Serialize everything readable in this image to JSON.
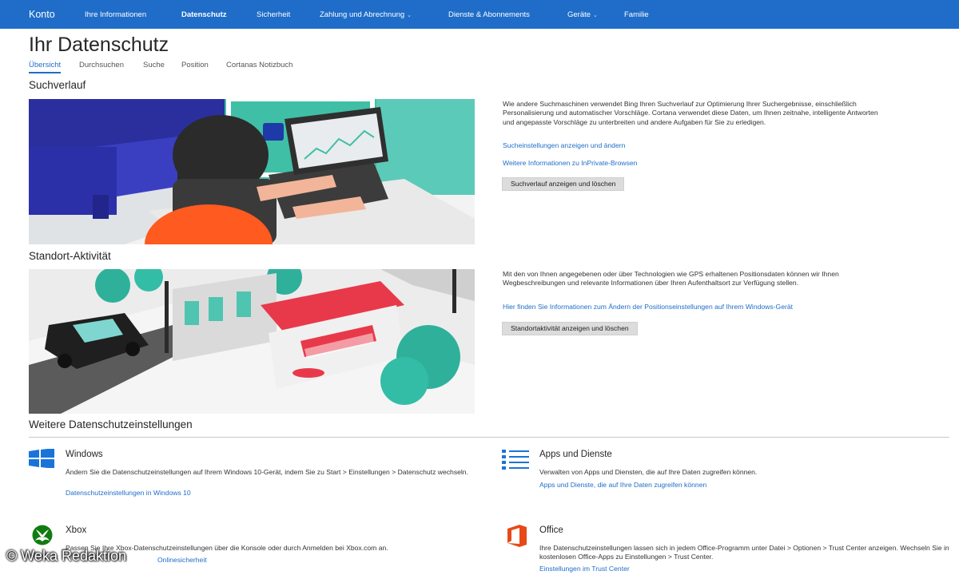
{
  "nav": {
    "brand": "Konto",
    "items": [
      {
        "label": "Ihre Informationen",
        "active": false,
        "dropdown": false
      },
      {
        "label": "Datenschutz",
        "active": true,
        "dropdown": false
      },
      {
        "label": "Sicherheit",
        "active": false,
        "dropdown": false
      },
      {
        "label": "Zahlung und Abrechnung",
        "active": false,
        "dropdown": true
      },
      {
        "label": "Dienste & Abonnements",
        "active": false,
        "dropdown": false
      },
      {
        "label": "Geräte",
        "active": false,
        "dropdown": true
      },
      {
        "label": "Familie",
        "active": false,
        "dropdown": false
      }
    ],
    "caret": "⌄"
  },
  "page": {
    "title": "Ihr Datenschutz",
    "tabs": [
      {
        "label": "Übersicht",
        "active": true
      },
      {
        "label": "Durchsuchen",
        "active": false
      },
      {
        "label": "Suche",
        "active": false
      },
      {
        "label": "Position",
        "active": false
      },
      {
        "label": "Cortanas Notizbuch",
        "active": false
      }
    ]
  },
  "search_history": {
    "heading": "Suchverlauf",
    "description": "Wie andere Suchmaschinen verwendet Bing Ihren Suchverlauf zur Optimierung Ihrer Suchergebnisse, einschließlich Personalisierung und automatischer Vorschläge. Cortana verwendet diese Daten, um Ihnen zeitnahe, intelligente Antworten und angepasste Vorschläge zu unterbreiten und andere Aufgaben für Sie zu erledigen.",
    "link1": "Sucheinstellungen anzeigen und ändern",
    "link2": "Weitere Informationen zu InPrivate-Browsen",
    "button": "Suchverlauf anzeigen und löschen"
  },
  "location": {
    "heading": "Standort-Aktivität",
    "description": "Mit den von Ihnen angegebenen oder über Technologien wie GPS erhaltenen Positionsdaten können wir Ihnen Wegbeschreibungen und relevante Informationen über Ihren Aufenthaltsort zur Verfügung stellen.",
    "link": "Hier finden Sie Informationen zum Ändern der Positionseinstellungen auf Ihrem Windows-Gerät",
    "button": "Standortaktivität anzeigen und löschen"
  },
  "more": {
    "heading": "Weitere Datenschutzeinstellungen",
    "tiles": [
      {
        "title": "Windows",
        "icon": "windows-logo-icon",
        "description": "Ändern Sie die Datenschutzeinstellungen auf Ihrem Windows 10-Gerät, indem Sie zu Start > Einstellungen > Datenschutz wechseln.",
        "link": "Datenschutzeinstellungen in Windows 10"
      },
      {
        "title": "Apps und Dienste",
        "icon": "list-icon",
        "description": "Verwalten von Apps und Diensten, die auf Ihre Daten zugreifen können.",
        "link": "Apps und Dienste, die auf Ihre Daten zugreifen können"
      },
      {
        "title": "Xbox",
        "icon": "xbox-logo-icon",
        "description": "Passen Sie Ihre Xbox-Datenschutzeinstellungen über die Konsole oder durch Anmelden bei Xbox.com an.",
        "link": "Onlinesicherheit"
      },
      {
        "title": "Office",
        "icon": "office-logo-icon",
        "description": "Ihre Datenschutzeinstellungen lassen sich in jedem Office-Programm unter Datei > Optionen > Trust Center anzeigen. Wechseln Sie in kostenlosen Office-Apps zu Einstellungen > Trust Center.",
        "link": "Einstellungen im Trust Center"
      }
    ]
  },
  "watermark": "© Weka Redaktion",
  "colors": {
    "nav_bg": "#1f6dc8",
    "link": "#1f6dc8",
    "windows_blue": "#1a74d8",
    "xbox_green": "#107c10",
    "office_orange": "#e64a19"
  }
}
